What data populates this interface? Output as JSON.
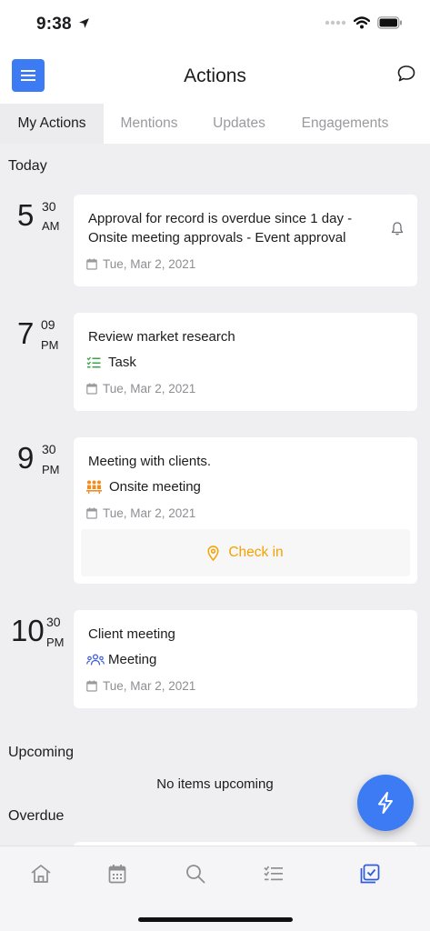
{
  "status": {
    "time": "9:38"
  },
  "header": {
    "title": "Actions",
    "menu_icon": "menu-icon",
    "chat_icon": "chat-icon",
    "accent": "#3d7bf5"
  },
  "tabs": [
    {
      "label": "My Actions",
      "active": true
    },
    {
      "label": "Mentions",
      "active": false
    },
    {
      "label": "Updates",
      "active": false
    },
    {
      "label": "Engagements",
      "active": false
    }
  ],
  "sections": {
    "today": "Today",
    "upcoming": "Upcoming",
    "overdue": "Overdue",
    "upcoming_empty": "No items upcoming"
  },
  "actions": [
    {
      "hour": "5",
      "minute": "30",
      "ampm": "AM",
      "title_line1": "Approval for record is overdue since 1 day -",
      "title_line2": "Onsite meeting approvals - Event approval",
      "date": "Tue, Mar 2, 2021",
      "has_bell": true
    },
    {
      "hour": "7",
      "minute": "09",
      "ampm": "PM",
      "title": "Review market research",
      "type": "Task",
      "type_icon": "task-list-icon",
      "date": "Tue, Mar 2, 2021"
    },
    {
      "hour": "9",
      "minute": "30",
      "ampm": "PM",
      "title": "Meeting with clients.",
      "type": "Onsite meeting",
      "type_icon": "onsite-meeting-icon",
      "date": "Tue, Mar 2, 2021",
      "checkin_label": "Check in"
    },
    {
      "hour": "10",
      "minute": "30",
      "ampm": "PM",
      "title": "Client meeting",
      "type": "Meeting",
      "type_icon": "meeting-people-icon",
      "date": "Tue, Mar 2, 2021"
    }
  ],
  "bottom_nav": [
    {
      "icon": "home-icon",
      "active": false
    },
    {
      "icon": "calendar-icon",
      "active": false
    },
    {
      "icon": "search-icon",
      "active": false
    },
    {
      "icon": "task-list-icon",
      "active": false
    },
    {
      "icon": "actions-icon",
      "active": true
    }
  ],
  "fab": {
    "icon": "lightning-icon"
  },
  "colors": {
    "checkin": "#f5a100",
    "task_green": "#3aa64a",
    "onsite_orange": "#f28c1f",
    "meeting_blue": "#3d5bd6"
  }
}
